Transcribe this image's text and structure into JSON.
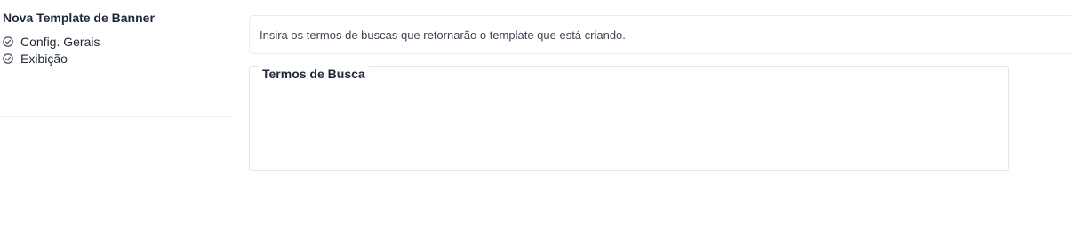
{
  "sidebar": {
    "title": "Nova Template de Banner",
    "steps": [
      {
        "label": "Config. Gerais",
        "icon": "check-circle-icon"
      },
      {
        "label": "Exibição",
        "icon": "check-circle-icon"
      }
    ]
  },
  "info": {
    "text": "Insira os termos de buscas que retornarão o template que está criando."
  },
  "search_terms": {
    "legend": "Termos de Busca",
    "value": ""
  },
  "colors": {
    "text": "#1f2937",
    "title": "#1e293b",
    "border": "#e2e5ea"
  }
}
